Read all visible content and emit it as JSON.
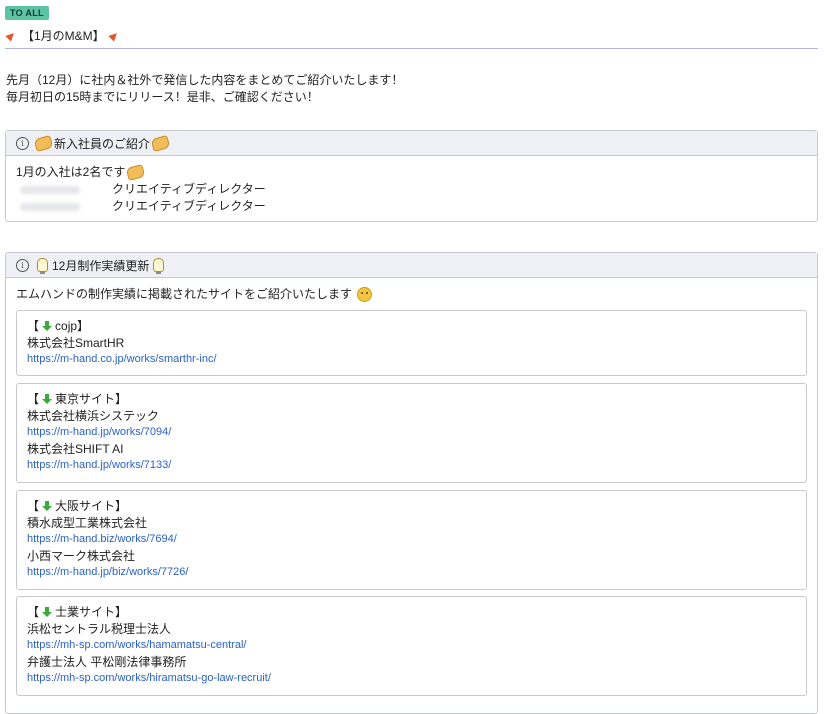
{
  "badge": "TO ALL",
  "title": "【1月のM&M】",
  "intro": {
    "line1": "先月（12月）に社内＆社外で発信した内容をまとめてご紹介いたします！",
    "line2": "毎月初日の15時までにリリース！是非、ご確認ください！"
  },
  "new_members": {
    "heading": "新入社員のご紹介",
    "lead": "1月の入社は2名です",
    "members": [
      {
        "role": "クリエイティブディレクター"
      },
      {
        "role": "クリエイティブディレクター"
      }
    ]
  },
  "works": {
    "heading": "12月制作実績更新",
    "lead": "エムハンドの制作実績に掲載されたサイトをご紹介いたします",
    "groups": [
      {
        "label_open": "【",
        "label": "cojp】",
        "entries": [
          {
            "company": "株式会社SmartHR",
            "url": "https://m-hand.co.jp/works/smarthr-inc/"
          }
        ]
      },
      {
        "label_open": "【",
        "label": "東京サイト】",
        "entries": [
          {
            "company": "株式会社横浜システック",
            "url": "https://m-hand.jp/works/7094/"
          },
          {
            "company": "株式会社SHIFT AI",
            "url": "https://m-hand.jp/works/7133/"
          }
        ]
      },
      {
        "label_open": "【",
        "label": "大阪サイト】",
        "entries": [
          {
            "company": "積水成型工業株式会社",
            "url": "https://m-hand.biz/works/7694/"
          },
          {
            "company": "小西マーク株式会社",
            "url": "https://m-hand.jp/biz/works/7726/"
          }
        ]
      },
      {
        "label_open": "【",
        "label": "士業サイト】",
        "entries": [
          {
            "company": "浜松セントラル税理士法人",
            "url": "https://mh-sp.com/works/hamamatsu-central/"
          },
          {
            "company": "弁護士法人 平松剛法律事務所",
            "url": "https://mh-sp.com/works/hiramatsu-go-law-recruit/"
          }
        ]
      }
    ]
  },
  "colors": {
    "badge_bg": "#5cc3a3",
    "panel_header_bg": "#eef0f5",
    "link": "#2a62c9",
    "separator": "#b3b6e8"
  }
}
